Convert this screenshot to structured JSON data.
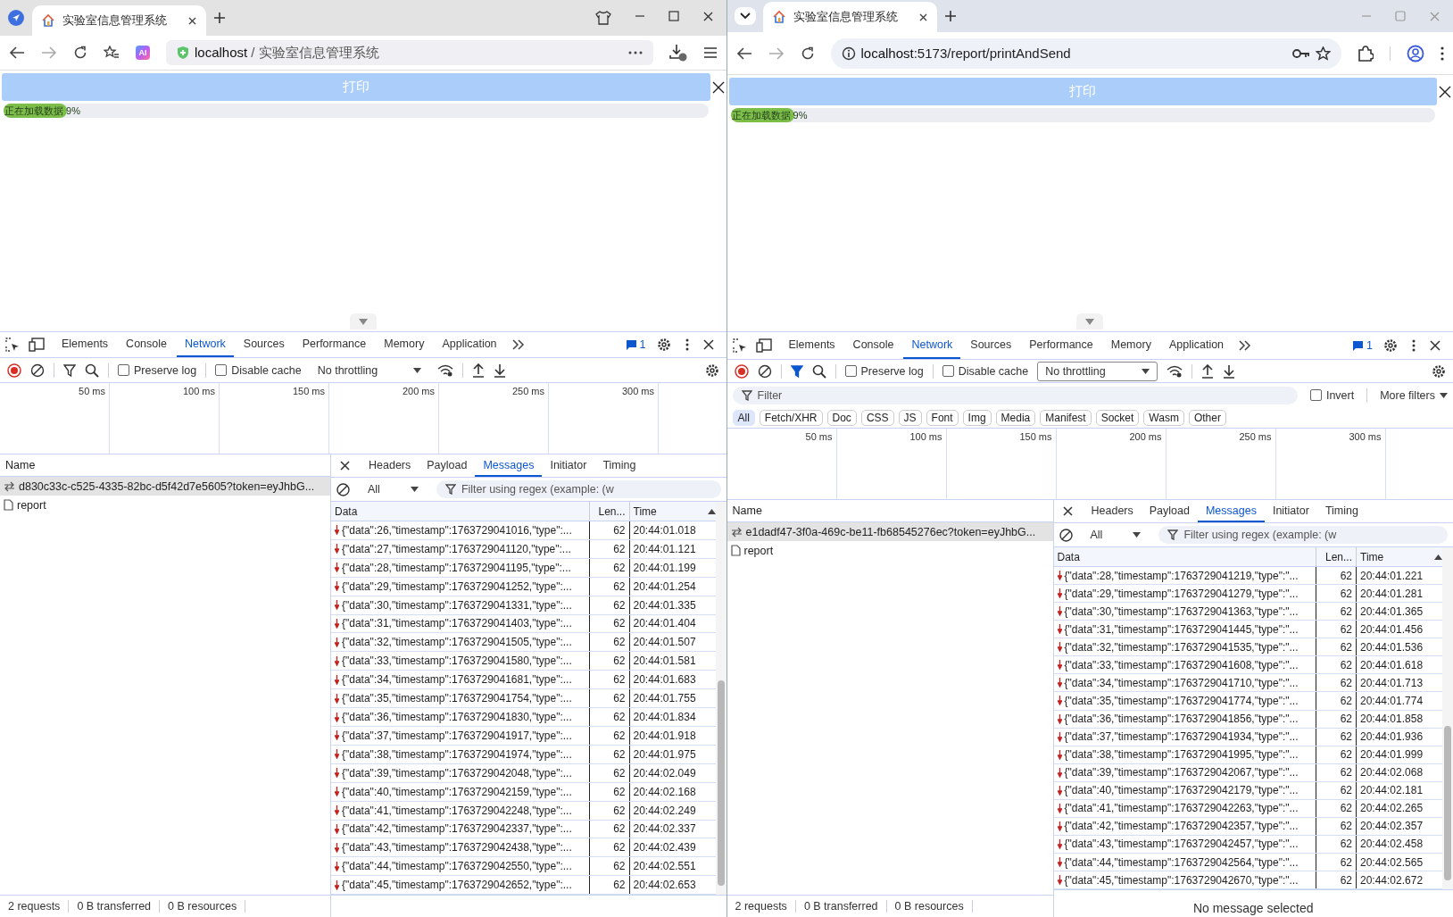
{
  "windows": [
    {
      "kind": "classic",
      "tab": {
        "title": "实验室信息管理系统"
      },
      "address": {
        "host": "localhost",
        "rest": " / 实验室信息管理系统"
      },
      "extension_badge": "AI",
      "page": {
        "print_button": "打印",
        "progress": {
          "label": "正在加载数据 9%",
          "level": 0.09
        }
      },
      "devtools": {
        "tabs": [
          {
            "label": "Elements",
            "selected": false
          },
          {
            "label": "Console",
            "selected": false
          },
          {
            "label": "Network",
            "selected": true
          },
          {
            "label": "Sources",
            "selected": false
          },
          {
            "label": "Performance",
            "selected": false
          },
          {
            "label": "Memory",
            "selected": false
          },
          {
            "label": "Application",
            "selected": false
          }
        ],
        "issues_count": "1",
        "toolbar": {
          "filter_active": false,
          "preserve_log": {
            "label": "Preserve log",
            "checked": false
          },
          "disable_cache": {
            "label": "Disable cache",
            "checked": false
          },
          "throttling": "No throttling"
        },
        "timeline_ticks": [
          "50 ms",
          "100 ms",
          "150 ms",
          "200 ms",
          "250 ms",
          "300 ms"
        ],
        "name_header": "Name",
        "requests": [
          {
            "kind": "websocket",
            "name": "d830c33c-c525-4335-82bc-d5f42d7e5605?token=eyJhbG...",
            "selected": true
          },
          {
            "kind": "document",
            "name": "report",
            "selected": false
          }
        ],
        "detail": {
          "tabs": [
            {
              "label": "Headers",
              "selected": false
            },
            {
              "label": "Payload",
              "selected": false
            },
            {
              "label": "Messages",
              "selected": true
            },
            {
              "label": "Initiator",
              "selected": false
            },
            {
              "label": "Timing",
              "selected": false
            }
          ],
          "direction_filter": "All",
          "regex_placeholder": "Filter using regex (example: (w",
          "columns": [
            "Data",
            "Len...",
            "Time"
          ],
          "messages": [
            {
              "data": "{\"data\":26,\"timestamp\":1763729041016,\"type\":...",
              "length": "62",
              "time": "20:44:01.018"
            },
            {
              "data": "{\"data\":27,\"timestamp\":1763729041120,\"type\":...",
              "length": "62",
              "time": "20:44:01.121"
            },
            {
              "data": "{\"data\":28,\"timestamp\":1763729041195,\"type\":...",
              "length": "62",
              "time": "20:44:01.199"
            },
            {
              "data": "{\"data\":29,\"timestamp\":1763729041252,\"type\":...",
              "length": "62",
              "time": "20:44:01.254"
            },
            {
              "data": "{\"data\":30,\"timestamp\":1763729041331,\"type\":...",
              "length": "62",
              "time": "20:44:01.335"
            },
            {
              "data": "{\"data\":31,\"timestamp\":1763729041403,\"type\":...",
              "length": "62",
              "time": "20:44:01.404"
            },
            {
              "data": "{\"data\":32,\"timestamp\":1763729041505,\"type\":...",
              "length": "62",
              "time": "20:44:01.507"
            },
            {
              "data": "{\"data\":33,\"timestamp\":1763729041580,\"type\":...",
              "length": "62",
              "time": "20:44:01.581"
            },
            {
              "data": "{\"data\":34,\"timestamp\":1763729041681,\"type\":...",
              "length": "62",
              "time": "20:44:01.683"
            },
            {
              "data": "{\"data\":35,\"timestamp\":1763729041754,\"type\":...",
              "length": "62",
              "time": "20:44:01.755"
            },
            {
              "data": "{\"data\":36,\"timestamp\":1763729041830,\"type\":...",
              "length": "62",
              "time": "20:44:01.834"
            },
            {
              "data": "{\"data\":37,\"timestamp\":1763729041917,\"type\":...",
              "length": "62",
              "time": "20:44:01.918"
            },
            {
              "data": "{\"data\":38,\"timestamp\":1763729041974,\"type\":...",
              "length": "62",
              "time": "20:44:01.975"
            },
            {
              "data": "{\"data\":39,\"timestamp\":1763729042048,\"type\":...",
              "length": "62",
              "time": "20:44:02.049"
            },
            {
              "data": "{\"data\":40,\"timestamp\":1763729042159,\"type\":...",
              "length": "62",
              "time": "20:44:02.168"
            },
            {
              "data": "{\"data\":41,\"timestamp\":1763729042248,\"type\":...",
              "length": "62",
              "time": "20:44:02.249"
            },
            {
              "data": "{\"data\":42,\"timestamp\":1763729042337,\"type\":...",
              "length": "62",
              "time": "20:44:02.337"
            },
            {
              "data": "{\"data\":43,\"timestamp\":1763729042438,\"type\":...",
              "length": "62",
              "time": "20:44:02.439"
            },
            {
              "data": "{\"data\":44,\"timestamp\":1763729042550,\"type\":...",
              "length": "62",
              "time": "20:44:02.551"
            },
            {
              "data": "{\"data\":45,\"timestamp\":1763729042652,\"type\":...",
              "length": "62",
              "time": "20:44:02.653"
            }
          ]
        },
        "status": [
          "2 requests",
          "0 B transferred",
          "0 B resources"
        ]
      }
    },
    {
      "kind": "chrome",
      "tab": {
        "title": "实验室信息管理系统"
      },
      "address": {
        "host": "localhost",
        "rest": ":5173/report/printAndSend"
      },
      "page": {
        "print_button": "打印",
        "progress": {
          "label": "正在加载数据 9%",
          "level": 0.09
        }
      },
      "devtools": {
        "tabs": [
          {
            "label": "Elements",
            "selected": false
          },
          {
            "label": "Console",
            "selected": false
          },
          {
            "label": "Network",
            "selected": true
          },
          {
            "label": "Sources",
            "selected": false
          },
          {
            "label": "Performance",
            "selected": false
          },
          {
            "label": "Memory",
            "selected": false
          },
          {
            "label": "Application",
            "selected": false
          }
        ],
        "issues_count": "1",
        "toolbar": {
          "filter_active": true,
          "preserve_log": {
            "label": "Preserve log",
            "checked": false
          },
          "disable_cache": {
            "label": "Disable cache",
            "checked": false
          },
          "throttling": "No throttling"
        },
        "filter_bar": {
          "placeholder": "Filter",
          "invert": {
            "label": "Invert",
            "checked": false
          },
          "more_filters": "More filters"
        },
        "type_chips": [
          {
            "label": "All",
            "selected": true
          },
          {
            "label": "Fetch/XHR",
            "selected": false
          },
          {
            "label": "Doc",
            "selected": false
          },
          {
            "label": "CSS",
            "selected": false
          },
          {
            "label": "JS",
            "selected": false
          },
          {
            "label": "Font",
            "selected": false
          },
          {
            "label": "Img",
            "selected": false
          },
          {
            "label": "Media",
            "selected": false
          },
          {
            "label": "Manifest",
            "selected": false
          },
          {
            "label": "Socket",
            "selected": false
          },
          {
            "label": "Wasm",
            "selected": false
          },
          {
            "label": "Other",
            "selected": false
          }
        ],
        "timeline_ticks": [
          "50 ms",
          "100 ms",
          "150 ms",
          "200 ms",
          "250 ms",
          "300 ms"
        ],
        "name_header": "Name",
        "requests": [
          {
            "kind": "websocket",
            "name": "e1dadf47-3f0a-469c-be11-fb68545276ec?token=eyJhbG...",
            "selected": true
          },
          {
            "kind": "document",
            "name": "report",
            "selected": false
          }
        ],
        "detail": {
          "tabs": [
            {
              "label": "Headers",
              "selected": false
            },
            {
              "label": "Payload",
              "selected": false
            },
            {
              "label": "Messages",
              "selected": true
            },
            {
              "label": "Initiator",
              "selected": false
            },
            {
              "label": "Timing",
              "selected": false
            }
          ],
          "direction_filter": "All",
          "regex_placeholder": "Filter using regex (example: (w",
          "columns": [
            "Data",
            "Len...",
            "Time"
          ],
          "messages": [
            {
              "data": "{\"data\":28,\"timestamp\":1763729041219,\"type\":\"...",
              "length": "62",
              "time": "20:44:01.221"
            },
            {
              "data": "{\"data\":29,\"timestamp\":1763729041279,\"type\":\"...",
              "length": "62",
              "time": "20:44:01.281"
            },
            {
              "data": "{\"data\":30,\"timestamp\":1763729041363,\"type\":\"...",
              "length": "62",
              "time": "20:44:01.365"
            },
            {
              "data": "{\"data\":31,\"timestamp\":1763729041445,\"type\":\"...",
              "length": "62",
              "time": "20:44:01.456"
            },
            {
              "data": "{\"data\":32,\"timestamp\":1763729041535,\"type\":\"...",
              "length": "62",
              "time": "20:44:01.536"
            },
            {
              "data": "{\"data\":33,\"timestamp\":1763729041608,\"type\":\"...",
              "length": "62",
              "time": "20:44:01.618"
            },
            {
              "data": "{\"data\":34,\"timestamp\":1763729041710,\"type\":\"...",
              "length": "62",
              "time": "20:44:01.713"
            },
            {
              "data": "{\"data\":35,\"timestamp\":1763729041774,\"type\":\"...",
              "length": "62",
              "time": "20:44:01.774"
            },
            {
              "data": "{\"data\":36,\"timestamp\":1763729041856,\"type\":\"...",
              "length": "62",
              "time": "20:44:01.858"
            },
            {
              "data": "{\"data\":37,\"timestamp\":1763729041934,\"type\":\"...",
              "length": "62",
              "time": "20:44:01.936"
            },
            {
              "data": "{\"data\":38,\"timestamp\":1763729041995,\"type\":\"...",
              "length": "62",
              "time": "20:44:01.999"
            },
            {
              "data": "{\"data\":39,\"timestamp\":1763729042067,\"type\":\"...",
              "length": "62",
              "time": "20:44:02.068"
            },
            {
              "data": "{\"data\":40,\"timestamp\":1763729042179,\"type\":\"...",
              "length": "62",
              "time": "20:44:02.181"
            },
            {
              "data": "{\"data\":41,\"timestamp\":1763729042263,\"type\":\"...",
              "length": "62",
              "time": "20:44:02.265"
            },
            {
              "data": "{\"data\":42,\"timestamp\":1763729042357,\"type\":\"...",
              "length": "62",
              "time": "20:44:02.357"
            },
            {
              "data": "{\"data\":43,\"timestamp\":1763729042457,\"type\":\"...",
              "length": "62",
              "time": "20:44:02.458"
            },
            {
              "data": "{\"data\":44,\"timestamp\":1763729042564,\"type\":\"...",
              "length": "62",
              "time": "20:44:02.565"
            },
            {
              "data": "{\"data\":45,\"timestamp\":1763729042670,\"type\":\"...",
              "length": "62",
              "time": "20:44:02.672"
            }
          ],
          "empty_message": "No message selected"
        },
        "status": [
          "2 requests",
          "0 B transferred",
          "0 B resources"
        ]
      }
    }
  ]
}
